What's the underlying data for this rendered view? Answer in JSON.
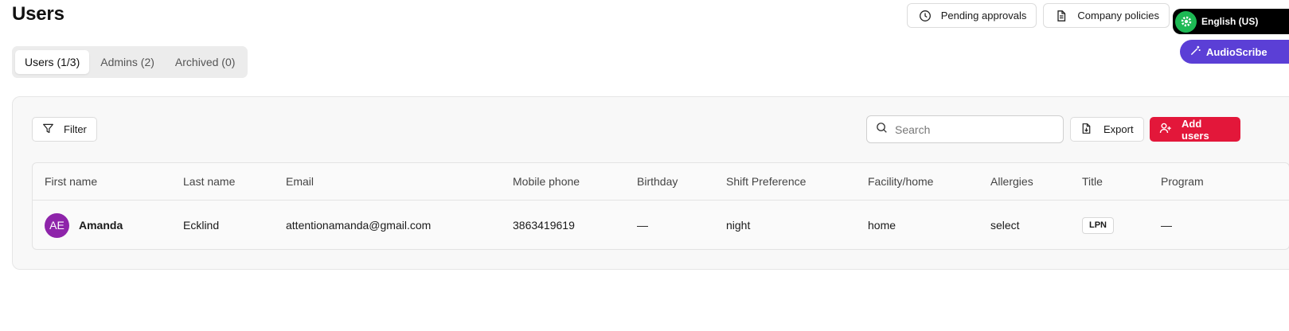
{
  "header": {
    "title": "Users"
  },
  "top_actions": {
    "pending_label": "Pending approvals",
    "policies_label": "Company policies"
  },
  "extensions": {
    "language_label": "English (US)",
    "audio_label": "AudioScribe"
  },
  "tabs": [
    {
      "label": "Users (1/3)",
      "active": true
    },
    {
      "label": "Admins (2)",
      "active": false
    },
    {
      "label": "Archived (0)",
      "active": false
    }
  ],
  "toolbar": {
    "filter_label": "Filter",
    "search_placeholder": "Search",
    "export_label": "Export",
    "add_label": "Add users"
  },
  "table": {
    "columns": [
      "First name",
      "Last name",
      "Email",
      "Mobile phone",
      "Birthday",
      "Shift Preference",
      "Facility/home",
      "Allergies",
      "Title",
      "Program"
    ],
    "rows": [
      {
        "initials": "AE",
        "first_name": "Amanda",
        "last_name": "Ecklind",
        "email": "attentionamanda@gmail.com",
        "mobile_phone": "3863419619",
        "birthday": "—",
        "shift_preference": "night",
        "facility": "home",
        "allergies": "select",
        "title": "LPN",
        "program": "—"
      }
    ]
  },
  "colors": {
    "accent": "#e3173a",
    "avatar": "#8e24aa",
    "language_chip": "#000000",
    "audio_chip": "#5b3fd6",
    "gear": "#1db954"
  }
}
